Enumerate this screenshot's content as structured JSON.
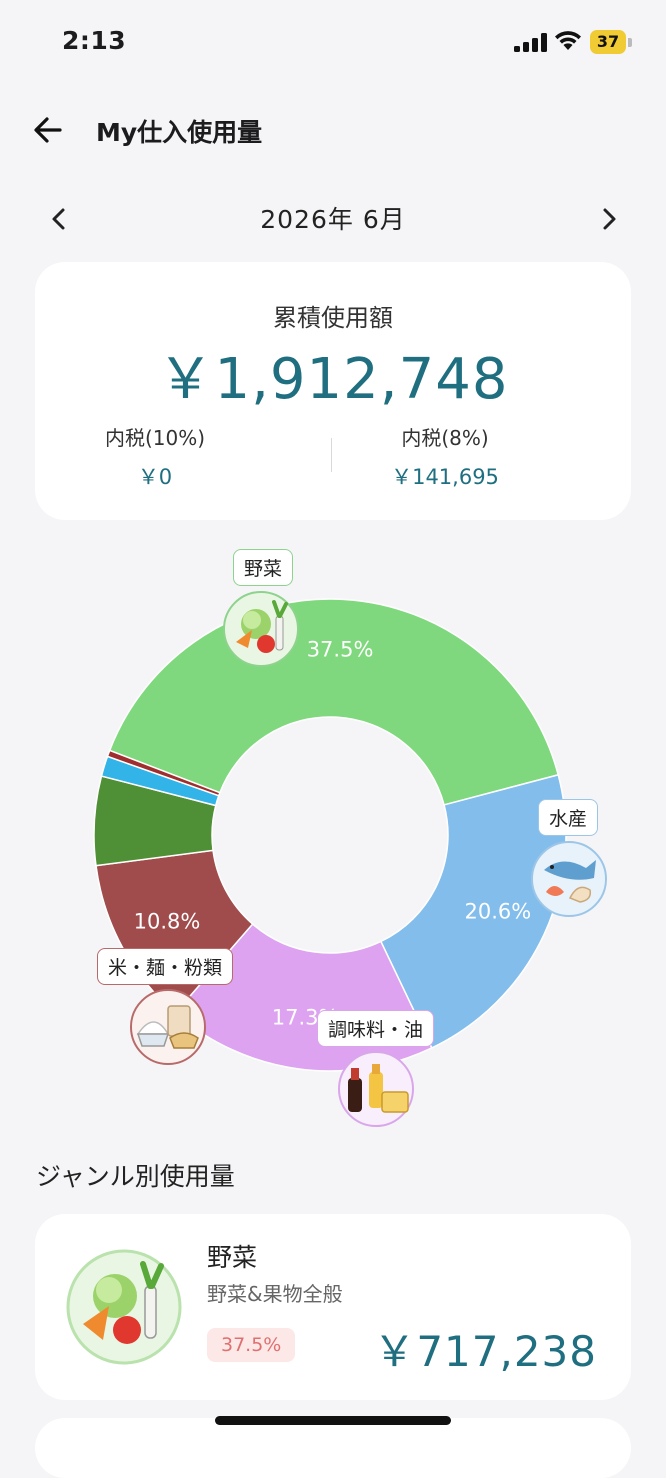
{
  "status_bar": {
    "time": "2:13",
    "battery": "37"
  },
  "header": {
    "title": "My仕入使用量"
  },
  "month_nav": {
    "label": "2026年 6月"
  },
  "summary": {
    "label": "累積使用額",
    "total": "￥1,912,748",
    "tax10_label": "内税(10%)",
    "tax10_value": "￥0",
    "tax8_label": "内税(8%)",
    "tax8_value": "￥141,695"
  },
  "chart_data": {
    "type": "pie",
    "categories": [
      "野菜",
      "水産",
      "調味料・油",
      "米・麺・粉類",
      "",
      "",
      ""
    ],
    "values": [
      37.5,
      20.6,
      17.3,
      10.8,
      5.7,
      1.3,
      0.4
    ],
    "value_labels": [
      "37.5%",
      "20.6%",
      "17.3%",
      "10.8%"
    ],
    "colors": [
      "#7fd87d",
      "#82bdeb",
      "#dda3f0",
      "#a04c4c",
      "#4f8f35",
      "#33b4e8",
      "#a02e2e"
    ]
  },
  "callouts": {
    "veg": "野菜",
    "seafood": "水産",
    "seasoning": "調味料・油",
    "rice": "米・麺・粉類"
  },
  "genre_section": {
    "title": "ジャンル別使用量",
    "items": [
      {
        "name": "野菜",
        "desc": "野菜&果物全般",
        "badge": "37.5%",
        "amount": "￥717,238"
      }
    ]
  }
}
